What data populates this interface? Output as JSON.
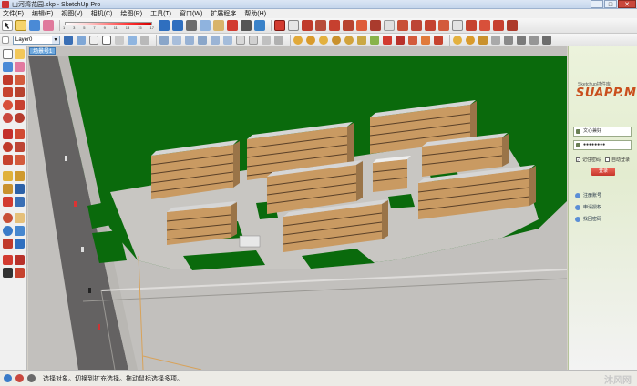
{
  "window": {
    "title": "山河湾花园.skp - SketchUp Pro",
    "minimize": "–",
    "maximize": "□",
    "close": "✕"
  },
  "menu": [
    "文件(F)",
    "编辑(E)",
    "视图(V)",
    "相机(C)",
    "绘图(R)",
    "工具(T)",
    "窗口(W)",
    "扩展程序",
    "帮助(H)"
  ],
  "toolbar1": {
    "scale_ticks": [
      "1",
      "3",
      "5",
      "7",
      "9",
      "11",
      "13",
      "15",
      "17"
    ],
    "icons": [
      "select-icon",
      "component-icon",
      "paint-icon",
      "eraser-icon",
      "undo-icon",
      "redo-icon",
      "cut-icon",
      "copy-icon",
      "paste-icon",
      "delete-icon",
      "print-icon",
      "model-info-icon"
    ],
    "right_icons": [
      "su-logo-icon",
      "zoom-icon",
      "camera-icon",
      "orbit-icon",
      "pan-icon",
      "zoom-window-icon",
      "zoom-extents-icon",
      "previous-icon",
      "position-camera-icon",
      "walk-icon",
      "look-around-icon",
      "section-plane-icon",
      "display-section-icon",
      "axes-icon",
      "guide-icon",
      "dimension-icon",
      "text-icon",
      "3d-text-icon"
    ]
  },
  "toolbar2": {
    "layer": "Layer0"
  },
  "scene": {
    "tab": "场景号1"
  },
  "right_panel": {
    "tagline": "Sketchup插件库",
    "logo": "SUAPP.ME",
    "username": "文心兼好",
    "password": "●●●●●●●●",
    "remember": "记住密码",
    "auto_login": "自动登录",
    "login_button": "登录",
    "links": [
      "注册账号",
      "申请授权",
      "找回密码"
    ]
  },
  "status": {
    "text": "选择对象。切换到扩充选择。拖动鼠标选择多项。",
    "watermark": "沐风网"
  },
  "colors": {
    "grass": "#0a6a0c",
    "ground": "#c2c0bd",
    "road": "#646262",
    "building_wall": "#c99a62",
    "building_roof": "#d6d6d6",
    "accent_red": "#d23b30"
  }
}
